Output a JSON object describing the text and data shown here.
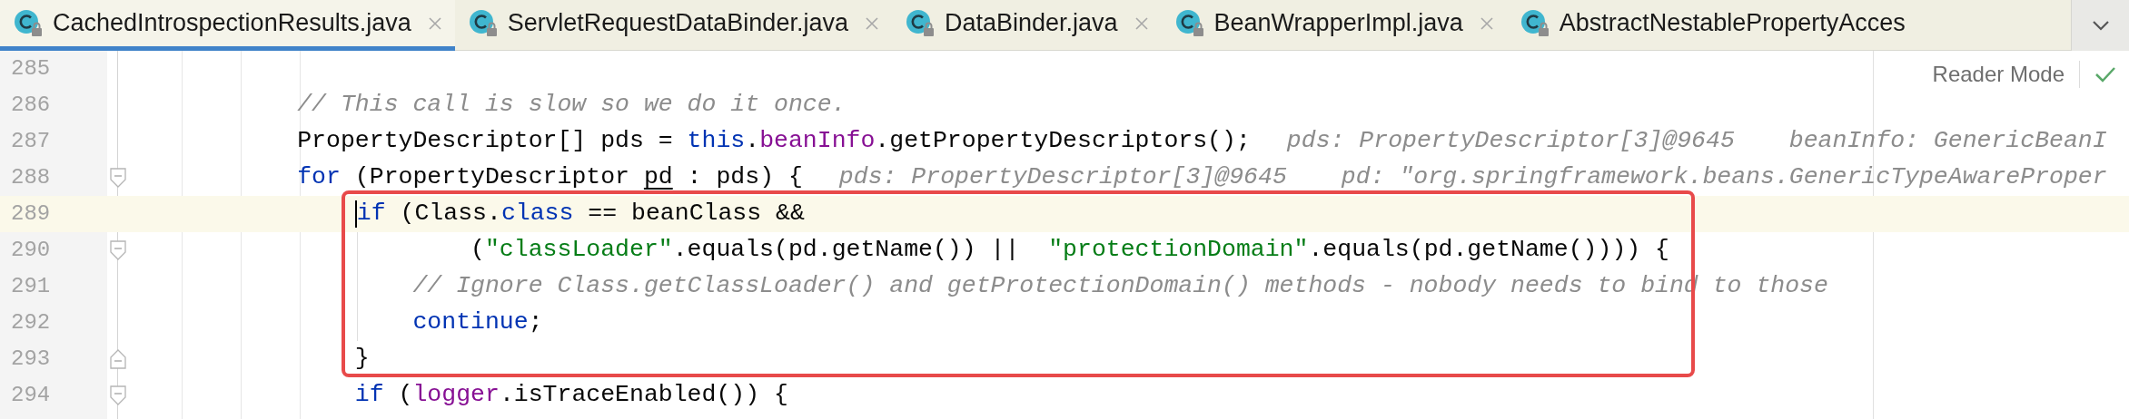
{
  "tabs": [
    {
      "label": "CachedIntrospectionResults.java",
      "selected": true,
      "closable": true
    },
    {
      "label": "ServletRequestDataBinder.java",
      "selected": false,
      "closable": true
    },
    {
      "label": "DataBinder.java",
      "selected": false,
      "closable": true
    },
    {
      "label": "BeanWrapperImpl.java",
      "selected": false,
      "closable": true
    },
    {
      "label": "AbstractNestablePropertyAcces",
      "selected": false,
      "closable": false
    }
  ],
  "reader_mode": {
    "label": "Reader Mode"
  },
  "lines": [
    {
      "number": "285",
      "current": false,
      "boxed": false,
      "fold_start": false,
      "fold_end": false
    },
    {
      "number": "286",
      "current": false,
      "boxed": false,
      "fold_start": false,
      "fold_end": false,
      "tokens": [
        {
          "kind": "comment",
          "text": "        // This call is slow so we do it once."
        }
      ]
    },
    {
      "number": "287",
      "current": false,
      "boxed": false,
      "fold_start": false,
      "fold_end": false,
      "tokens": [
        {
          "kind": "plain",
          "text": "        PropertyDescriptor[] pds = "
        },
        {
          "kind": "keyword",
          "text": "this"
        },
        {
          "kind": "plain",
          "text": "."
        },
        {
          "kind": "field",
          "text": "beanInfo"
        },
        {
          "kind": "plain",
          "text": ".getPropertyDescriptors();"
        }
      ],
      "hints": [
        "pds: PropertyDescriptor[3]@9645",
        "beanInfo: GenericBeanI"
      ]
    },
    {
      "number": "288",
      "current": false,
      "boxed": false,
      "fold_start": true,
      "fold_end": false,
      "tokens": [
        {
          "kind": "keyword",
          "text": "        for"
        },
        {
          "kind": "plain",
          "text": " (PropertyDescriptor "
        },
        {
          "kind": "underlined",
          "text": "pd"
        },
        {
          "kind": "plain",
          "text": " : pds) {"
        }
      ],
      "hints": [
        "pds: PropertyDescriptor[3]@9645",
        "pd: \"org.springframework.beans.GenericTypeAwareProper"
      ]
    },
    {
      "number": "289",
      "current": true,
      "boxed": true,
      "fold_start": false,
      "fold_end": false,
      "tokens": [
        {
          "kind": "keyword",
          "text": "if"
        },
        {
          "kind": "plain",
          "text": " (Class."
        },
        {
          "kind": "keyword",
          "text": "class"
        },
        {
          "kind": "plain",
          "text": " == beanClass &&"
        }
      ]
    },
    {
      "number": "290",
      "current": false,
      "boxed": true,
      "fold_start": true,
      "fold_end": false,
      "tokens": [
        {
          "kind": "plain",
          "text": "                    ("
        },
        {
          "kind": "string",
          "text": "\"classLoader\""
        },
        {
          "kind": "plain",
          "text": ".equals(pd.getName()) ||  "
        },
        {
          "kind": "string",
          "text": "\"protectionDomain\""
        },
        {
          "kind": "plain",
          "text": ".equals(pd.getName()))) {"
        }
      ]
    },
    {
      "number": "291",
      "current": false,
      "boxed": true,
      "fold_start": false,
      "fold_end": false,
      "tokens": [
        {
          "kind": "comment",
          "text": "                // Ignore Class.getClassLoader() and getProtectionDomain() methods - nobody needs to bind to those"
        }
      ]
    },
    {
      "number": "292",
      "current": false,
      "boxed": true,
      "fold_start": false,
      "fold_end": false,
      "tokens": [
        {
          "kind": "keyword",
          "text": "                continue"
        },
        {
          "kind": "plain",
          "text": ";"
        }
      ]
    },
    {
      "number": "293",
      "current": false,
      "boxed": true,
      "fold_start": false,
      "fold_end": true,
      "tokens": [
        {
          "kind": "plain",
          "text": "            }"
        }
      ]
    },
    {
      "number": "294",
      "current": false,
      "boxed": false,
      "fold_start": true,
      "fold_end": false,
      "tokens": [
        {
          "kind": "keyword",
          "text": "            if"
        },
        {
          "kind": "plain",
          "text": " ("
        },
        {
          "kind": "field",
          "text": "logger"
        },
        {
          "kind": "plain",
          "text": ".isTraceEnabled()) {"
        }
      ]
    }
  ]
}
